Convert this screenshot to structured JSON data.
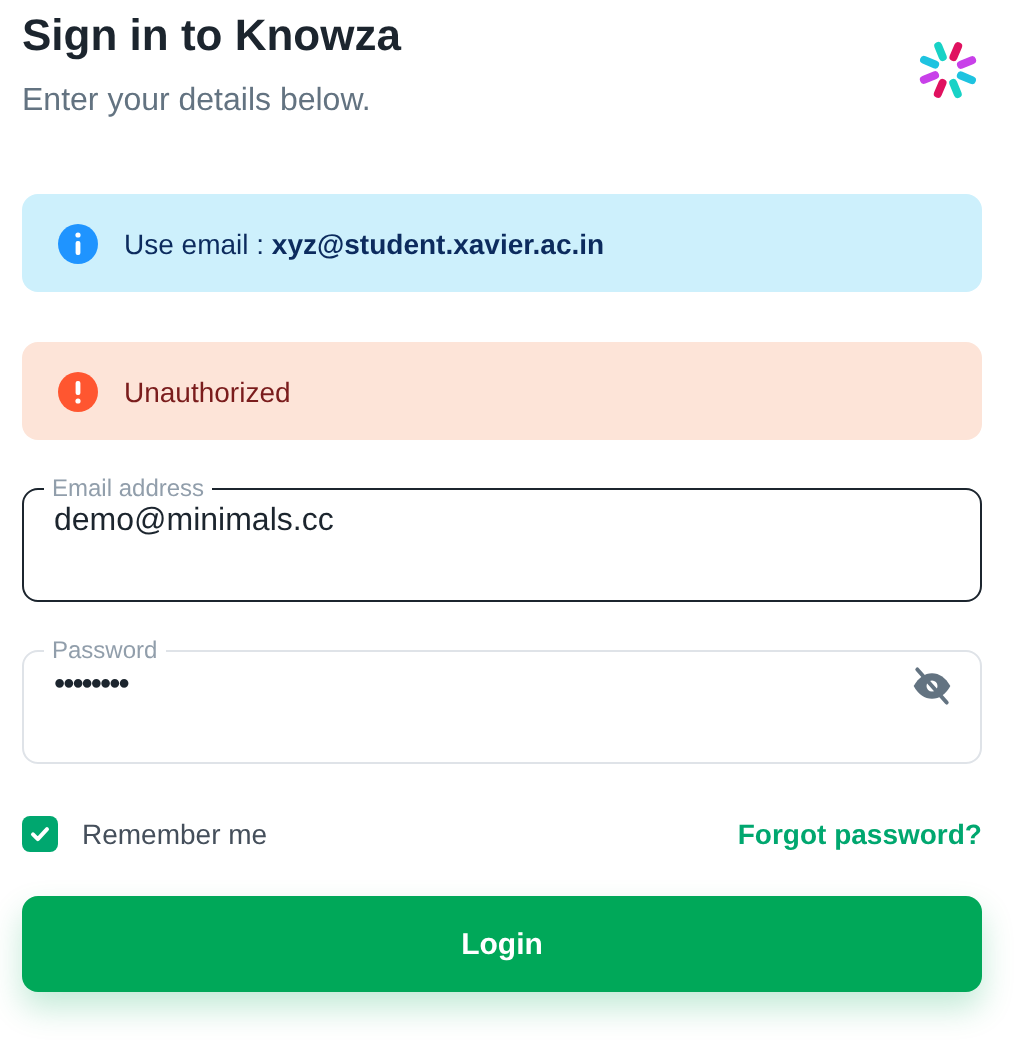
{
  "header": {
    "title": "Sign in to Knowza",
    "subtitle": "Enter your details below."
  },
  "alerts": [
    {
      "kind": "info",
      "text": "Use email : **xyz@student.xavier.ac.in**"
    },
    {
      "kind": "error",
      "text": "Unauthorized"
    }
  ],
  "fields": [
    {
      "label": "Email address",
      "value": "demo@minimals.cc",
      "focused": true,
      "kind": "text"
    },
    {
      "label": "Password",
      "value": "••••••••",
      "focused": false,
      "kind": "password"
    }
  ],
  "remember": {
    "label": "Remember me",
    "checked": true
  },
  "forgot_link": "Forgot password?",
  "login_button": "Login"
}
